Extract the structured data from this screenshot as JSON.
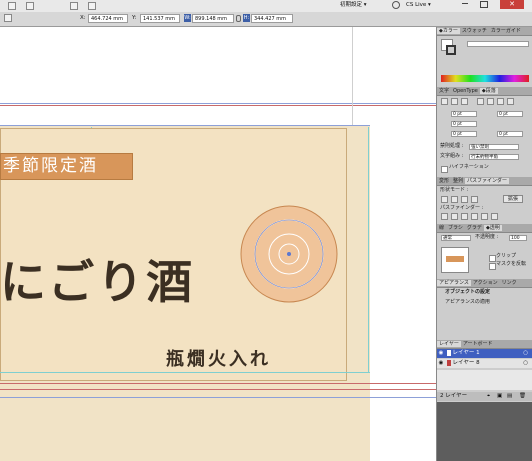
{
  "app": {
    "workspace_label": "初期設定 ▾",
    "search_placeholder": "CS Live ▾"
  },
  "control": {
    "x_label": "X:",
    "x_value": "464.724 mm",
    "y_label": "Y:",
    "y_value": "141.537 mm",
    "w_label": "W:",
    "w_value": "899.148 mm",
    "h_label": "H:",
    "h_value": "344.427 mm"
  },
  "artwork": {
    "band_text": "季節限定酒",
    "title_text": "にごり酒",
    "subtitle_text": "瓶燗火入れ",
    "band_color": "#d8965a",
    "text_color": "#3b2f22",
    "paper_color": "#f1e3c6"
  },
  "color_panel": {
    "tabs": [
      "◆カラー",
      "スウォッチ",
      "カラーガイド"
    ]
  },
  "para_panel": {
    "tabs": [
      "文字",
      "OpenType",
      "◆段落"
    ],
    "fields": [
      "0 pt",
      "0 pt",
      "0 pt",
      "0 pt",
      "0 pt"
    ],
    "kinsoku_label": "禁則処理 :",
    "kinsoku_value": "強い禁則",
    "mojikumi_label": "文字組み :",
    "mojikumi_value": "行末約物半角",
    "hyphen_label": "ハイフネーション"
  },
  "pathfinder_panel": {
    "tabs": [
      "変形",
      "整列",
      "パスファインダー"
    ],
    "shape_mode_label": "形状モード :",
    "expand_button": "拡張",
    "pathfinder_label": "パスファインダー :"
  },
  "transparency_panel": {
    "tabs": [
      "線",
      "ブラシ",
      "グラデ",
      "◆透明"
    ],
    "mode_value": "通常",
    "opacity_label": "不透明度 :",
    "opacity_value": "100",
    "clip_label": "クリップ",
    "mask_label": "マスクを反転"
  },
  "appearance_panel": {
    "tabs": [
      "アピアランス",
      "アクション",
      "リンク"
    ],
    "object_label": "オブジェクトの設定",
    "appearance_label": "アピアランスの適用"
  },
  "layers_panel": {
    "tabs": [
      "レイヤー",
      "アートボード"
    ],
    "layers": [
      {
        "name": "レイヤー 1",
        "selected": true,
        "color": "#3f5fc0"
      },
      {
        "name": "レイヤー 8",
        "selected": false,
        "color": "#c04040"
      }
    ],
    "count_label": "2 レイヤー"
  }
}
